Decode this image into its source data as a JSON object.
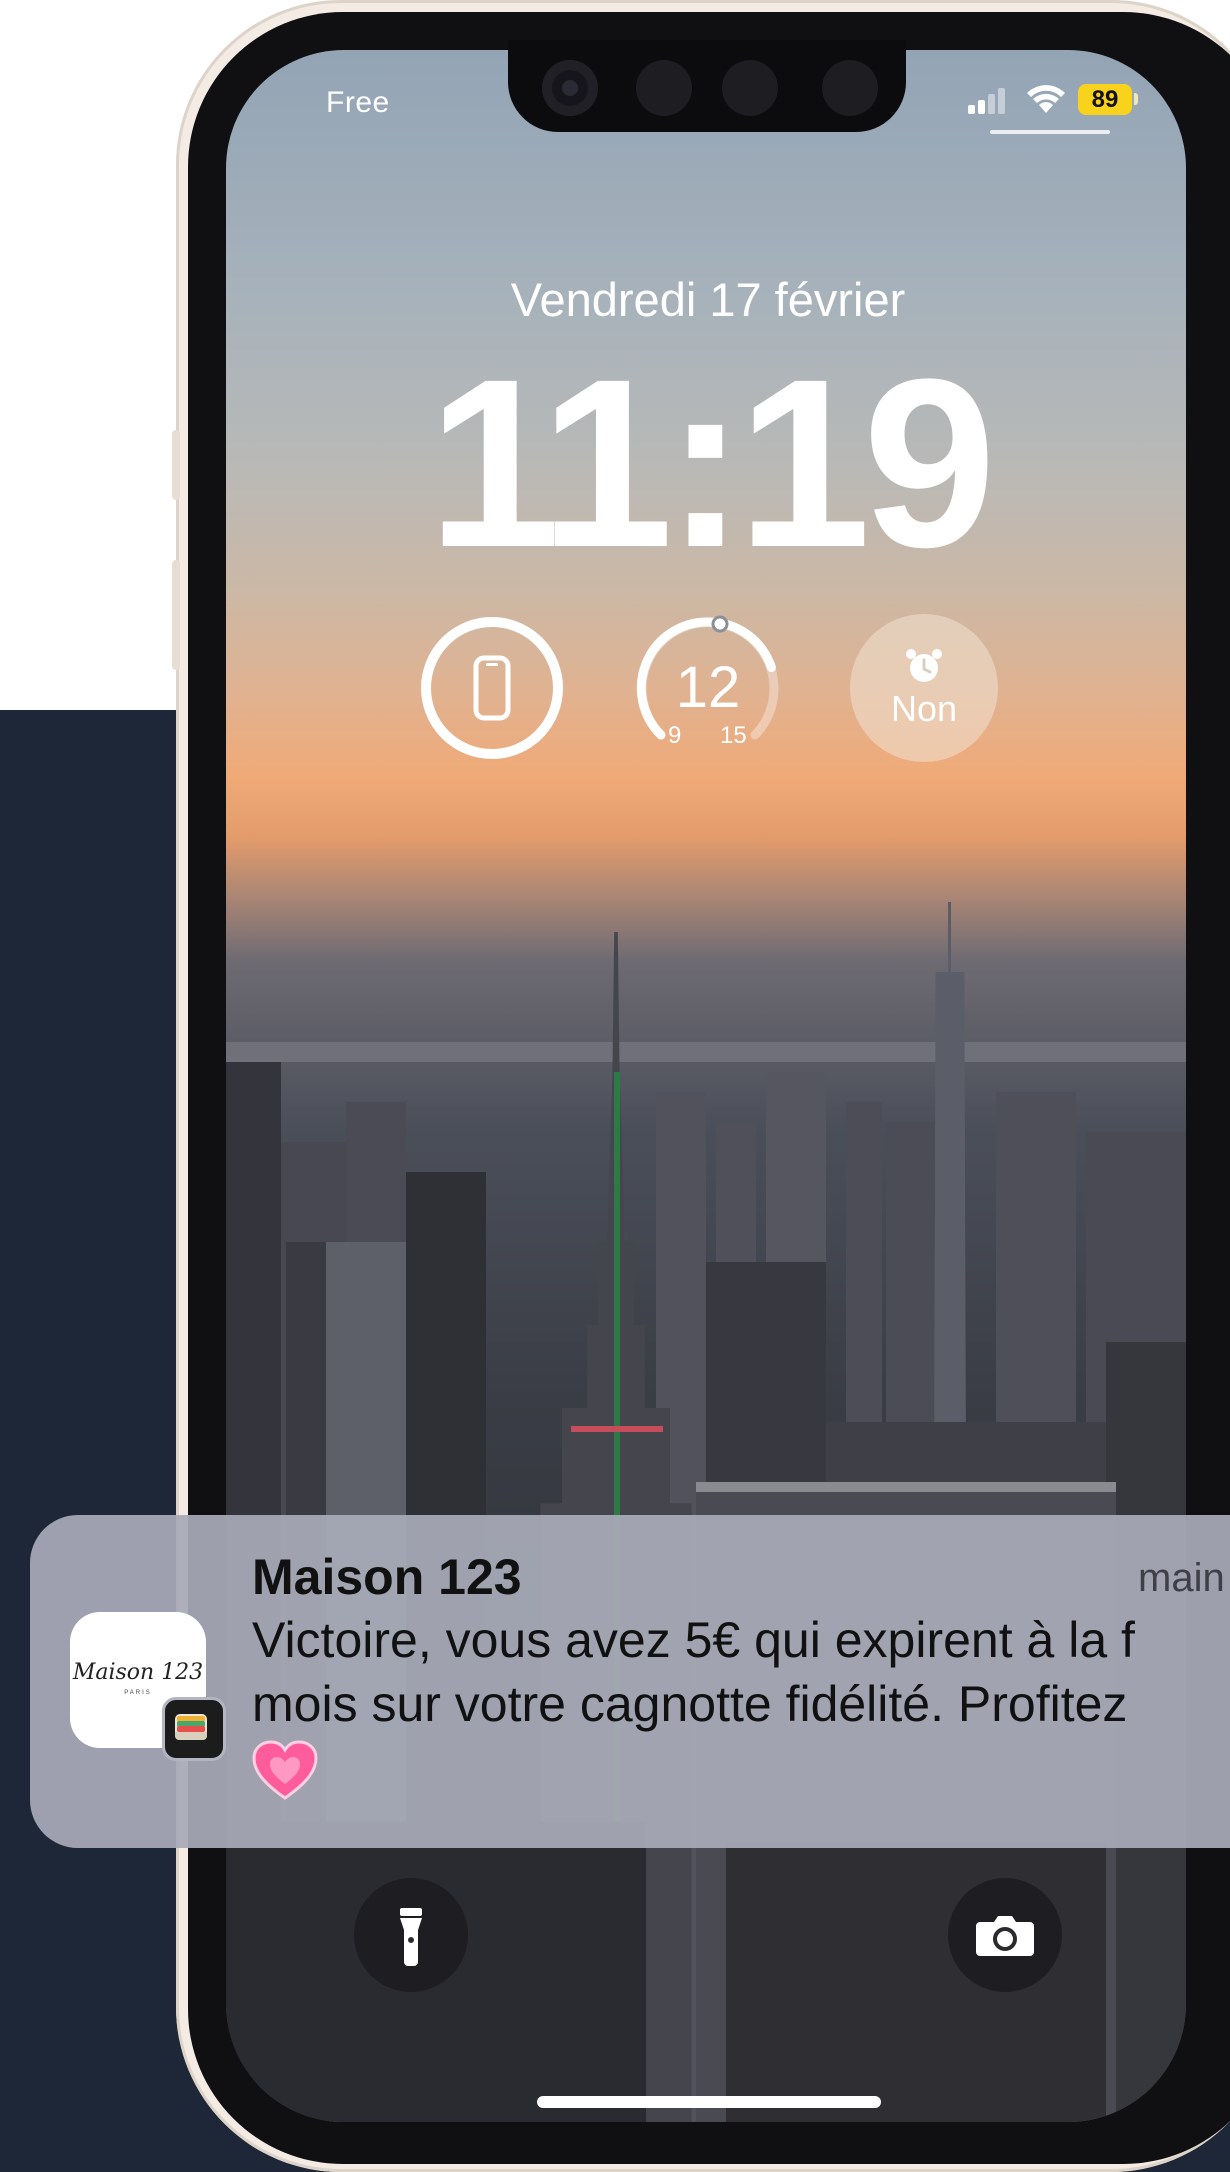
{
  "status_bar": {
    "carrier": "Free",
    "battery_level": "89",
    "signal_icon": "cellular-signal-icon",
    "wifi_icon": "wifi-icon"
  },
  "lockscreen": {
    "date": "Vendredi 17 février",
    "time": "11:19"
  },
  "widgets": {
    "battery": {
      "icon": "phone-icon"
    },
    "temperature": {
      "value": "12",
      "min": "9",
      "max": "15"
    },
    "alarm": {
      "icon": "alarm-clock-icon",
      "label": "Non"
    }
  },
  "notification": {
    "app_name": "Maison 123",
    "meta": "main",
    "body_line1": "Victoire, vous avez 5€ qui expirent à la f",
    "body_line2": "mois sur votre cagnotte fidélité. Profitez",
    "emoji": "pink-heart-emoji",
    "app_icon_text": "Maison 123",
    "app_icon_subtext": "PARIS",
    "badge_icon": "wallet-icon"
  },
  "controls": {
    "left": "flashlight-icon",
    "right": "camera-icon"
  },
  "colors": {
    "background_panel": "#1e2738",
    "battery_badge": "#f8d21b",
    "heart": "#ff5c9e"
  }
}
